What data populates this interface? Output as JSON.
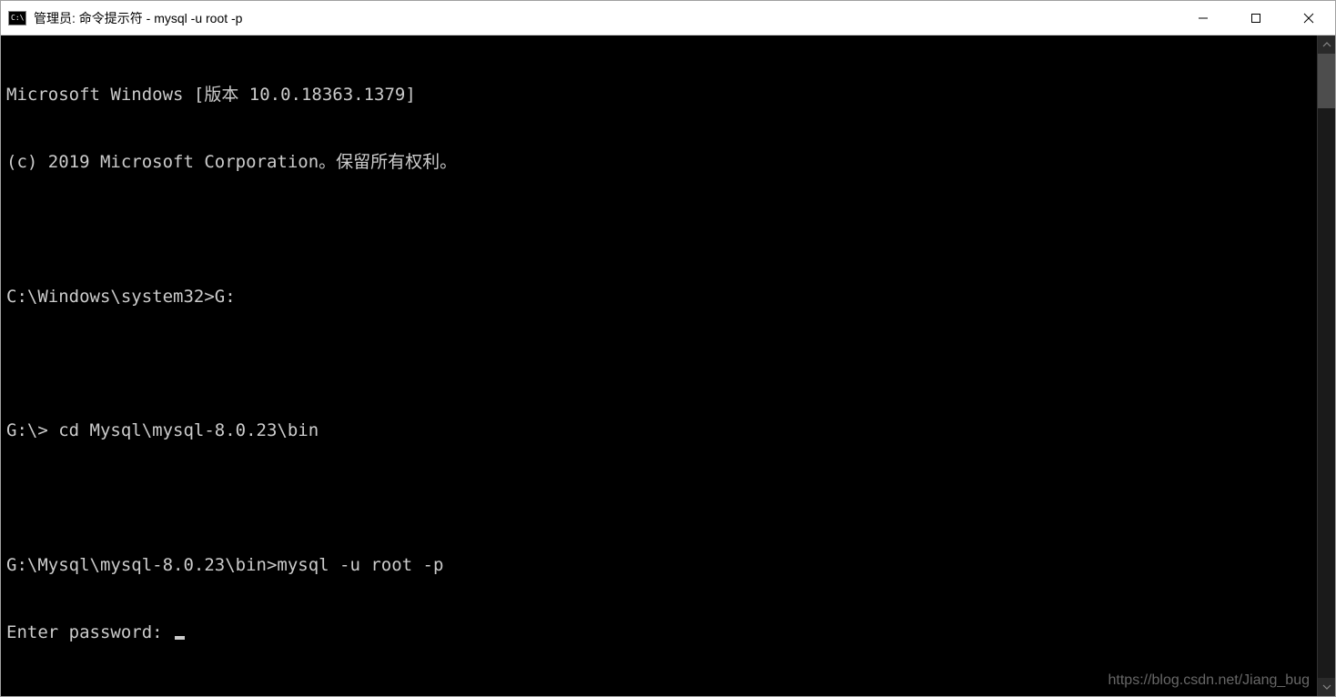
{
  "window": {
    "icon_text": "C:\\",
    "title": "管理员: 命令提示符 - mysql  -u root -p"
  },
  "terminal": {
    "lines": [
      "Microsoft Windows [版本 10.0.18363.1379]",
      "(c) 2019 Microsoft Corporation。保留所有权利。",
      "",
      "C:\\Windows\\system32>G:",
      "",
      "G:\\> cd Mysql\\mysql-8.0.23\\bin",
      "",
      "G:\\Mysql\\mysql-8.0.23\\bin>mysql -u root -p",
      "Enter password:"
    ]
  },
  "watermark": "https://blog.csdn.net/Jiang_bug"
}
